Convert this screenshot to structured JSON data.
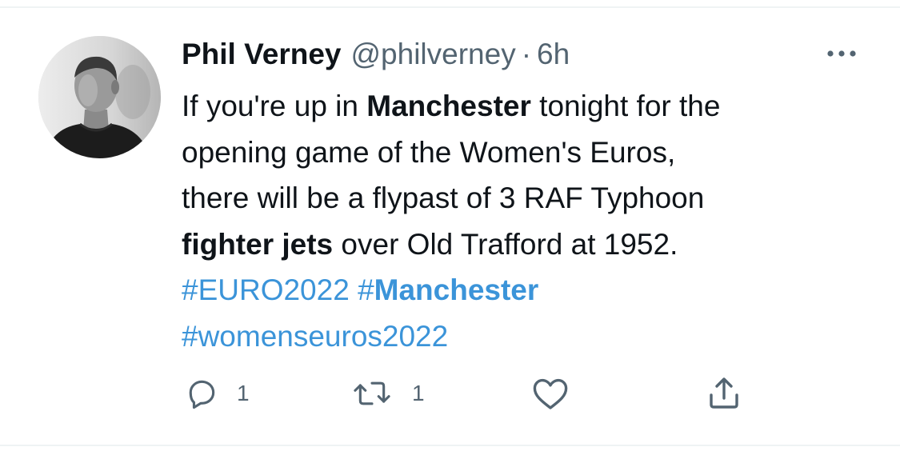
{
  "tweet": {
    "author_name": "Phil Verney",
    "author_handle": "@philverney",
    "separator": "·",
    "time": "6h",
    "more_label": "•••",
    "body": {
      "line1_a": "If you're up in ",
      "line1_b": "Manchester",
      "line1_c": " tonight for the",
      "line2": "opening game of the Women's Euros,",
      "line3": "there will be a flypast of 3 RAF Typhoon",
      "line4_a": "fighter jets",
      "line4_b": " over Old Trafford at 1952."
    },
    "hashtags": {
      "euro": "#EURO2022",
      "manchester_hash": "#",
      "manchester_word": "Manchester",
      "womens": "#womenseuros2022"
    },
    "actions": {
      "reply_count": "1",
      "retweet_count": "1",
      "like_count": "",
      "share_count": ""
    }
  },
  "colors": {
    "text": "#0f1419",
    "secondary": "#536471",
    "hashtag": "#3b94d9",
    "divider": "#eff3f4"
  },
  "icons": {
    "reply": "reply-icon",
    "retweet": "retweet-icon",
    "like": "like-icon",
    "share": "share-icon",
    "more": "more-icon"
  }
}
